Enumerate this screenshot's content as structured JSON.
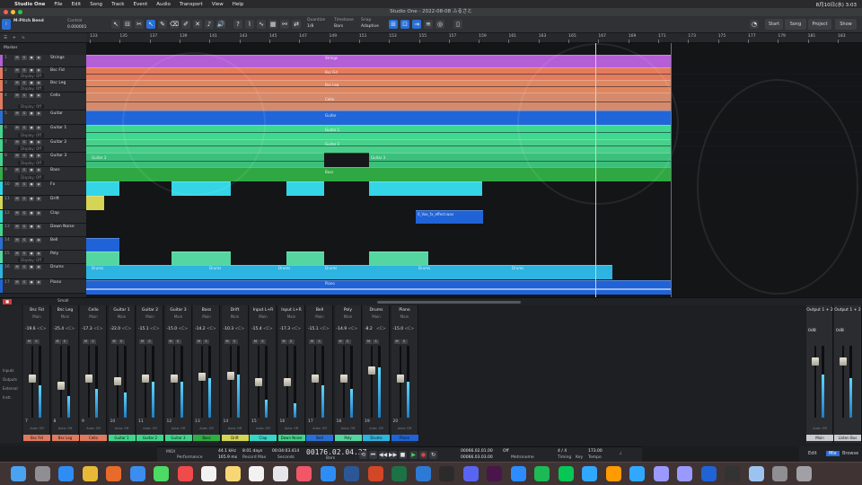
{
  "menubar": {
    "app": "Studio One",
    "items": [
      "File",
      "Edit",
      "Song",
      "Track",
      "Event",
      "Audio",
      "Transport",
      "View",
      "Help"
    ],
    "clock": "8月10日(水) 3:03"
  },
  "window_title": "Studio One - 2022-08-08 ふるさと",
  "toolbar": {
    "track_name": "M-Pitch Bend",
    "control_label": "Control",
    "position": "0.000001",
    "quantize_label": "Quantize",
    "quantize_val": "1/8",
    "timebase_label": "Timebase",
    "timebase_val": "Bars",
    "snap_label": "Snap",
    "snap_val": "Adaptive",
    "right_tabs": [
      "Start",
      "Song",
      "Project",
      "Show"
    ]
  },
  "ruler": {
    "ticks": [
      "133",
      "135",
      "137",
      "139",
      "141",
      "143",
      "145",
      "147",
      "149",
      "151",
      "153",
      "155",
      "157",
      "159",
      "161",
      "163",
      "165",
      "167",
      "169",
      "171",
      "173",
      "175",
      "177",
      "179",
      "181",
      "183"
    ]
  },
  "tracklist": {
    "head": "Marker",
    "tracks": [
      {
        "num": "1",
        "name": "Strings",
        "color": "#b45fd6"
      },
      {
        "num": "2",
        "name": "Bsc Fid",
        "color": "#e07a5f",
        "sub": "Display: Off"
      },
      {
        "num": "3",
        "name": "Bsc Leg",
        "color": "#e07a5f",
        "sub": "Display: Off"
      },
      {
        "num": "4",
        "name": "Cello",
        "color": "#e07a5f",
        "sub": "Display: Off"
      },
      {
        "num": "5",
        "name": "Guitar",
        "color": "#2a6fd6"
      },
      {
        "num": "6",
        "name": "Guitar 1",
        "color": "#3fd68c",
        "sub": "Display: Off"
      },
      {
        "num": "7",
        "name": "Guitar 2",
        "color": "#3fd68c",
        "sub": "Display: Off"
      },
      {
        "num": "8",
        "name": "Guitar 3",
        "color": "#3fd68c",
        "sub": "Display: Off"
      },
      {
        "num": "9",
        "name": "Bass",
        "color": "#2fae46",
        "sub": "Display: Off"
      },
      {
        "num": "10",
        "name": "Fx",
        "color": "#33d1e6"
      },
      {
        "num": "11",
        "name": "Drift",
        "color": "#d4d455"
      },
      {
        "num": "12",
        "name": "Clap",
        "color": "#36d6c8"
      },
      {
        "num": "13",
        "name": "Down Noise",
        "color": "#3fd68c"
      },
      {
        "num": "14",
        "name": "Bell",
        "color": "#2a6fd6"
      },
      {
        "num": "15",
        "name": "Poly",
        "color": "#55d6a0",
        "sub": "Display: Off"
      },
      {
        "num": "16",
        "name": "Drums",
        "color": "#2db4e0"
      },
      {
        "num": "17",
        "name": "Piano",
        "color": "#1f63d6"
      }
    ]
  },
  "arrange": {
    "clip_labels": {
      "strings": "Strings",
      "bsc_fid": "Bsc Fid",
      "bsc_leg": "Bsc Leg",
      "cello": "Cello",
      "guitar": "Guitar",
      "guitar1": "Guitar 1",
      "guitar2": "Guitar 2",
      "guitar3": "Guitar 3",
      "bass": "Bass",
      "fx_clip": "0_Vox_fx_effect.wav",
      "drums": "Drums",
      "piano": "Piano"
    }
  },
  "mixer": {
    "channels": [
      {
        "name": "Bsc Fid",
        "in": "Main",
        "val": "-19.6",
        "pan": "<C>",
        "num": "7",
        "label": "Bsc Fid",
        "color": "#e07a5f",
        "level": 0.45,
        "fader": 0.55
      },
      {
        "name": "Bsc Leg",
        "in": "Main",
        "val": "-25.4",
        "pan": "<C>",
        "num": "8",
        "label": "Bsc Leg",
        "color": "#e07a5f",
        "level": 0.3,
        "fader": 0.45
      },
      {
        "name": "Cello",
        "in": "Main",
        "val": "-17.3",
        "pan": "<C>",
        "num": "9",
        "label": "Cello",
        "color": "#e07a5f",
        "level": 0.4,
        "fader": 0.55
      },
      {
        "name": "Guitar 1",
        "in": "Main",
        "val": "-22.0",
        "pan": "<C>",
        "num": "10",
        "label": "Guitar 1",
        "color": "#3fd68c",
        "level": 0.35,
        "fader": 0.52
      },
      {
        "name": "Guitar 2",
        "in": "Main",
        "val": "-15.1",
        "pan": "<C>",
        "num": "11",
        "label": "Guitar 2",
        "color": "#3fd68c",
        "level": 0.5,
        "fader": 0.55
      },
      {
        "name": "Guitar 3",
        "in": "Main",
        "val": "-15.0",
        "pan": "<C>",
        "num": "12",
        "label": "Guitar 3",
        "color": "#3fd68c",
        "level": 0.5,
        "fader": 0.55
      },
      {
        "name": "Bass",
        "in": "Main",
        "val": "-14.2",
        "pan": "<C>",
        "num": "13",
        "label": "Bass",
        "color": "#2fae46",
        "level": 0.55,
        "fader": 0.58
      },
      {
        "name": "Drift",
        "in": "Main",
        "val": "-10.3",
        "pan": "<C>",
        "num": "14",
        "label": "Drift",
        "color": "#d4d455",
        "level": 0.6,
        "fader": 0.6
      },
      {
        "name": "Input L+R",
        "in": "Main",
        "val": "-15.4",
        "pan": "<C>",
        "num": "15",
        "label": "Clap",
        "color": "#36d6c8",
        "level": 0.25,
        "fader": 0.5
      },
      {
        "name": "Input L+R",
        "in": "Main",
        "val": "-17.3",
        "pan": "<C>",
        "num": "16",
        "label": "Down Noise",
        "color": "#3fd68c",
        "level": 0.2,
        "fader": 0.5
      },
      {
        "name": "Bell",
        "in": "Main",
        "val": "-15.1",
        "pan": "<C>",
        "num": "17",
        "label": "Bell",
        "color": "#2a6fd6",
        "level": 0.45,
        "fader": 0.55
      },
      {
        "name": "Poly",
        "in": "Main",
        "val": "-14.9",
        "pan": "<C>",
        "num": "18",
        "label": "Poly",
        "color": "#55d6a0",
        "level": 0.4,
        "fader": 0.55
      },
      {
        "name": "Drums",
        "in": "Main",
        "val": "-8.2",
        "pan": "<C>",
        "num": "19",
        "label": "Drums",
        "color": "#2db4e0",
        "level": 0.7,
        "fader": 0.68
      },
      {
        "name": "Piano",
        "in": "Main",
        "val": "-15.0",
        "pan": "<C>",
        "num": "20",
        "label": "Piano",
        "color": "#1f63d6",
        "level": 0.5,
        "fader": 0.55
      }
    ],
    "left_labels": [
      "Inputs",
      "Outputs",
      "External",
      "Instr."
    ],
    "outputs": [
      {
        "name": "Output 1 + 2",
        "val": "0dB",
        "label": "Main"
      },
      {
        "name": "Output 1 + 2",
        "val": "0dB",
        "label": "Listen Bus"
      }
    ]
  },
  "transport": {
    "midi": "MIDI",
    "performance": "Performance",
    "sample_rate": "44.1 kHz",
    "record_max": "8:01 days",
    "buffer": "165.9 ms",
    "record_label": "Record Max",
    "time": "00:04:03.414",
    "seconds_label": "Seconds",
    "bars": "00176.02.04.37",
    "bars_label": "Bars",
    "loop_start": "00066.02.01.00",
    "loop_end": "00066.03.03.00",
    "off_label": "Off",
    "metronome": "Metronome",
    "timing": "Timing",
    "signature": "4 / 4",
    "key": "Key",
    "tempo": "173.00",
    "tempo_label": "Tempo"
  },
  "bottom_tabs": [
    "Edit",
    "Mix",
    "Browse"
  ],
  "dock": {
    "apps": [
      "Finder",
      "Launchpad",
      "Safari",
      "Chrome",
      "Firefox",
      "Mail",
      "Messages",
      "Calendar",
      "Notion",
      "Notes",
      "Reminders",
      "Photos",
      "Music",
      "App Store",
      "Word",
      "PowerPoint",
      "Excel",
      "VS Code",
      "Terminal",
      "Discord",
      "Slack",
      "Zoom",
      "Spotify",
      "LINE",
      "Ps",
      "Ai",
      "Lr",
      "Pr",
      "Ae",
      "Studio One",
      "Logic",
      "Preview",
      "Settings",
      "Trash"
    ]
  }
}
